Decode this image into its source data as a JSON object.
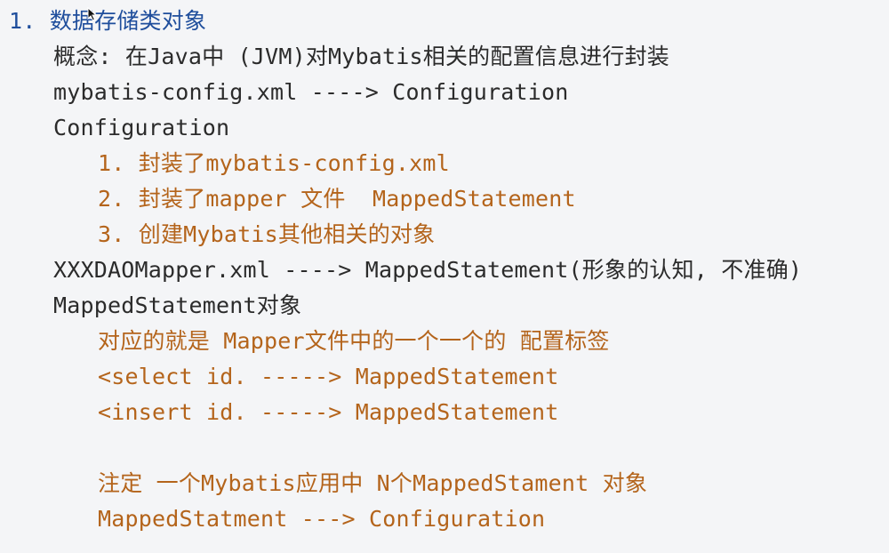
{
  "title": "1. 数据存储类对象",
  "lines": [
    "概念: 在Java中 (JVM)对Mybatis相关的配置信息进行封装",
    "mybatis-config.xml ----> Configuration",
    "Configuration",
    "1. 封装了mybatis-config.xml",
    "2. 封装了mapper 文件  MappedStatement",
    "3. 创建Mybatis其他相关的对象",
    "XXXDAOMapper.xml ----> MappedStatement(形象的认知, 不准确)",
    "MappedStatement对象",
    "对应的就是 Mapper文件中的一个一个的 配置标签",
    "<select id. -----> MappedStatement",
    "<insert id. -----> MappedStatement",
    "注定 一个Mybatis应用中 N个MappedStament 对象",
    "MappedStatment ---> Configuration"
  ],
  "colors": {
    "heading": "#1f4e9c",
    "text": "#2b2b2b",
    "accent": "#b4641b",
    "background": "#f4f5f7"
  },
  "cursor_icon": "mouse-pointer-icon"
}
